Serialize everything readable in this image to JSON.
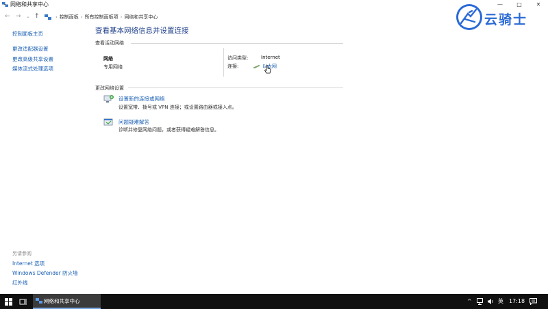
{
  "window": {
    "title": "网络和共享中心",
    "minimize_glyph": "—",
    "maximize_glyph": "□",
    "close_glyph": "✕"
  },
  "address": {
    "back_glyph": "←",
    "forward_glyph": "→",
    "history_glyph": "⌄",
    "up_glyph": "↑",
    "crumbs": [
      "控制面板",
      "所有控制面板项",
      "网络和共享中心"
    ],
    "sep_glyph": "›"
  },
  "leftnav": {
    "items": [
      "控制面板主页",
      "更改适配器设置",
      "更改高级共享设置",
      "媒体流式处理选项"
    ],
    "see_also_label": "另请参阅",
    "see_also": [
      "Internet 选项",
      "Windows Defender 防火墙",
      "红外线"
    ]
  },
  "main": {
    "title": "查看基本网络信息并设置连接",
    "active_label": "查看活动网络",
    "network_name": "网络",
    "network_type": "专用网络",
    "access_type_label": "访问类型:",
    "access_type_value": "Internet",
    "connection_label": "连接:",
    "connection_value": "以太网",
    "change_label": "更改网络设置",
    "tasks": [
      {
        "icon": "new-connection-icon",
        "title": "设置新的连接或网络",
        "desc": "设置宽带、拨号或 VPN 连接；或设置路由器或接入点。"
      },
      {
        "icon": "troubleshoot-icon",
        "title": "问题疑难解答",
        "desc": "诊断并修复网络问题，或者获得疑难解答信息。"
      }
    ]
  },
  "watermark": {
    "text": "云骑士"
  },
  "taskbar": {
    "app_label": "网络和共享中心",
    "tray_chevron": "^",
    "ime": "英",
    "time": "17:18"
  },
  "colors": {
    "link": "#1a5fb4",
    "title": "#1e3f8a",
    "taskbar": "#101010",
    "logo": "#2a6ad6"
  }
}
